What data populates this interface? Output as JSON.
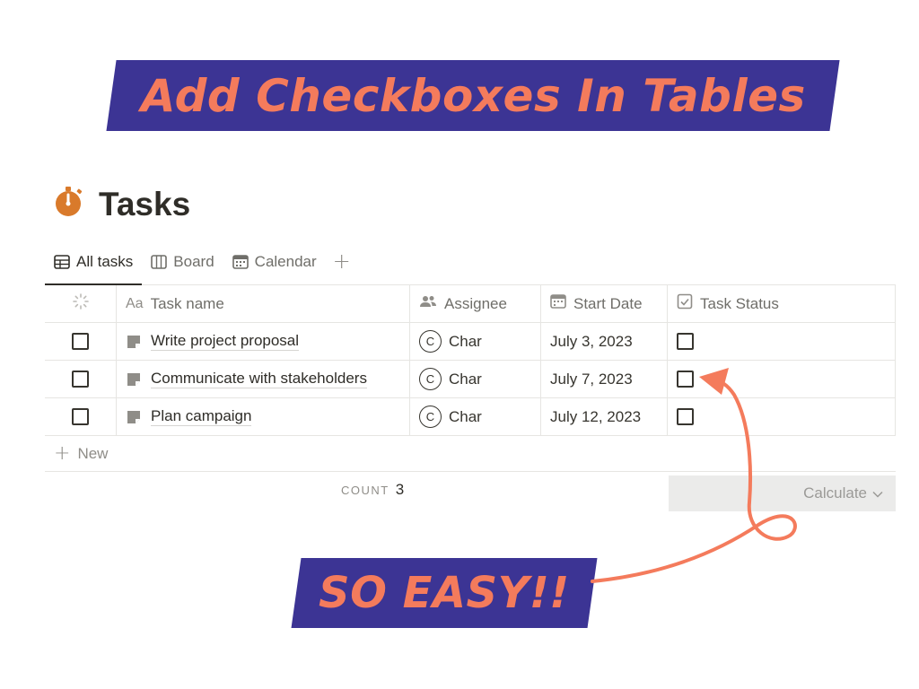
{
  "banner_top": {
    "text": "Add Checkboxes In Tables"
  },
  "banner_bottom": {
    "text": "SO EASY!!"
  },
  "page": {
    "title": "Tasks",
    "title_icon": "stopwatch-icon"
  },
  "tabs": [
    {
      "label": "All tasks",
      "icon": "table-icon",
      "active": true
    },
    {
      "label": "Board",
      "icon": "board-icon",
      "active": false
    },
    {
      "label": "Calendar",
      "icon": "calendar-icon",
      "active": false
    }
  ],
  "add_view": "+",
  "table": {
    "columns": [
      {
        "label": "",
        "icon": "spinner-icon"
      },
      {
        "label": "Task name",
        "prefix": "Aa"
      },
      {
        "label": "Assignee",
        "icon": "people-icon"
      },
      {
        "label": "Start Date",
        "icon": "calendar-icon"
      },
      {
        "label": "Task Status",
        "icon": "checkbox-icon"
      }
    ],
    "rows": [
      {
        "task": "Write project proposal",
        "assignee_initial": "C",
        "assignee": "Char",
        "start_date": "July 3, 2023",
        "status_checked": false,
        "selected": false
      },
      {
        "task": "Communicate with stakeholders",
        "assignee_initial": "C",
        "assignee": "Char",
        "start_date": "July 7, 2023",
        "status_checked": false,
        "selected": false
      },
      {
        "task": "Plan campaign",
        "assignee_initial": "C",
        "assignee": "Char",
        "start_date": "July 12, 2023",
        "status_checked": false,
        "selected": false
      }
    ],
    "new_label": "New",
    "count_label": "COUNT",
    "count_value": "3",
    "calculate_label": "Calculate"
  },
  "colors": {
    "banner_bg": "#3c3494",
    "accent": "#f47b5c",
    "text": "#37352f"
  }
}
